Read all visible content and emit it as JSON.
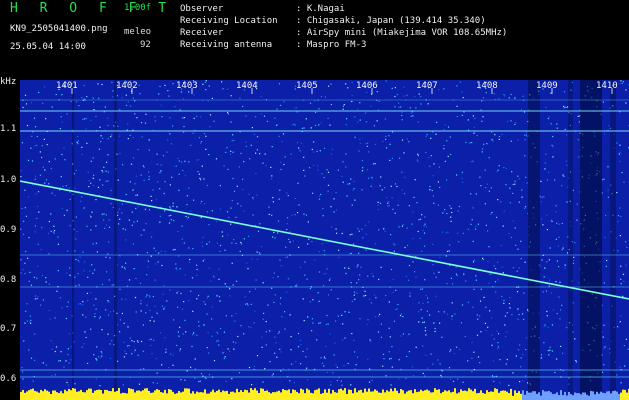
{
  "header": {
    "brand": "H R O F F T",
    "version": "1.00f",
    "filename": "KN9_2505041400.png",
    "datetime": "25.05.04 14:00",
    "meleo_label": "meleo",
    "meleo_value": "92",
    "meta": [
      {
        "key": "Observer",
        "value": ": K.Nagai"
      },
      {
        "key": "Receiving Location",
        "value": ": Chigasaki, Japan (139.414 35.340)"
      },
      {
        "key": "Receiver",
        "value": ": AirSpy mini (Miakejima VOR 108.65MHz)"
      },
      {
        "key": "Receiving antenna",
        "value": ": Maspro FM-3"
      }
    ]
  },
  "spectrogram": {
    "y_unit": "kHz",
    "y_ticks": [
      "1.1",
      "1.0",
      "0.9",
      "0.8",
      "0.7",
      "0.6"
    ],
    "x_ticks": [
      "1401",
      "1402",
      "1403",
      "1404",
      "1405",
      "1406",
      "1407",
      "1408",
      "1409",
      "1410"
    ],
    "background_color": "#0b1fa8",
    "trace_color": "#7cffd8"
  }
}
